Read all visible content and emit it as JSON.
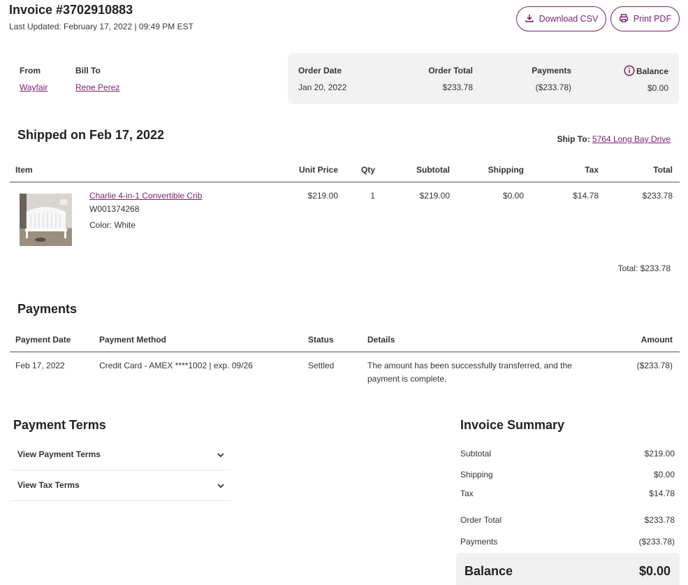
{
  "header": {
    "title": "Invoice #3702910883",
    "last_updated": "Last Updated: February 17, 2022 | 09:49 PM EST",
    "download_csv": "Download CSV",
    "print_pdf": "Print PDF"
  },
  "parties": {
    "from_label": "From",
    "from_value": "Wayfair",
    "bill_to_label": "Bill To",
    "bill_to_value": "Rene Perez"
  },
  "order_summary": {
    "order_date_label": "Order Date",
    "order_date_value": "Jan 20, 2022",
    "order_total_label": "Order Total",
    "order_total_value": "$233.78",
    "payments_label": "Payments",
    "payments_value": "($233.78)",
    "balance_label": "Balance",
    "balance_value": "$0.00"
  },
  "shipment": {
    "title": "Shipped on Feb 17, 2022",
    "ship_to_label": "Ship To:",
    "ship_to_value": "5764 Long Bay Drive",
    "columns": [
      "Item",
      "Unit Price",
      "Qty",
      "Subtotal",
      "Shipping",
      "Tax",
      "Total"
    ],
    "item": {
      "name": "Charlie 4-in-1 Convertible Crib",
      "sku": "W001374268",
      "color": "Color: White",
      "unit_price": "$219.00",
      "qty": "1",
      "subtotal": "$219.00",
      "shipping": "$0.00",
      "tax": "$14.78",
      "total": "$233.78"
    },
    "total_line": "Total: $233.78"
  },
  "payments": {
    "title": "Payments",
    "columns": [
      "Payment Date",
      "Payment Method",
      "Status",
      "Details",
      "Amount"
    ],
    "row": {
      "date": "Feb 17, 2022",
      "method": "Credit Card - AMEX ****1002 | exp. 09/26",
      "status": "Settled",
      "details_line1": "The amount has been successfully transferred, and the",
      "details_line2": "payment is complete.",
      "amount": "($233.78)"
    }
  },
  "payment_terms": {
    "title": "Payment Terms",
    "items": [
      "View Payment Terms",
      "View Tax Terms"
    ]
  },
  "invoice_summary": {
    "title": "Invoice Summary",
    "subtotal_label": "Subtotal",
    "subtotal_value": "$219.00",
    "shipping_label": "Shipping",
    "shipping_value": "$0.00",
    "tax_label": "Tax",
    "tax_value": "$14.78",
    "order_total_label": "Order Total",
    "order_total_value": "$233.78",
    "payments_label": "Payments",
    "payments_value": "($233.78)",
    "balance_label": "Balance",
    "balance_value": "$0.00"
  },
  "colors": {
    "accent": "#7b1f6e",
    "panel_bg": "#f2f2f2"
  }
}
